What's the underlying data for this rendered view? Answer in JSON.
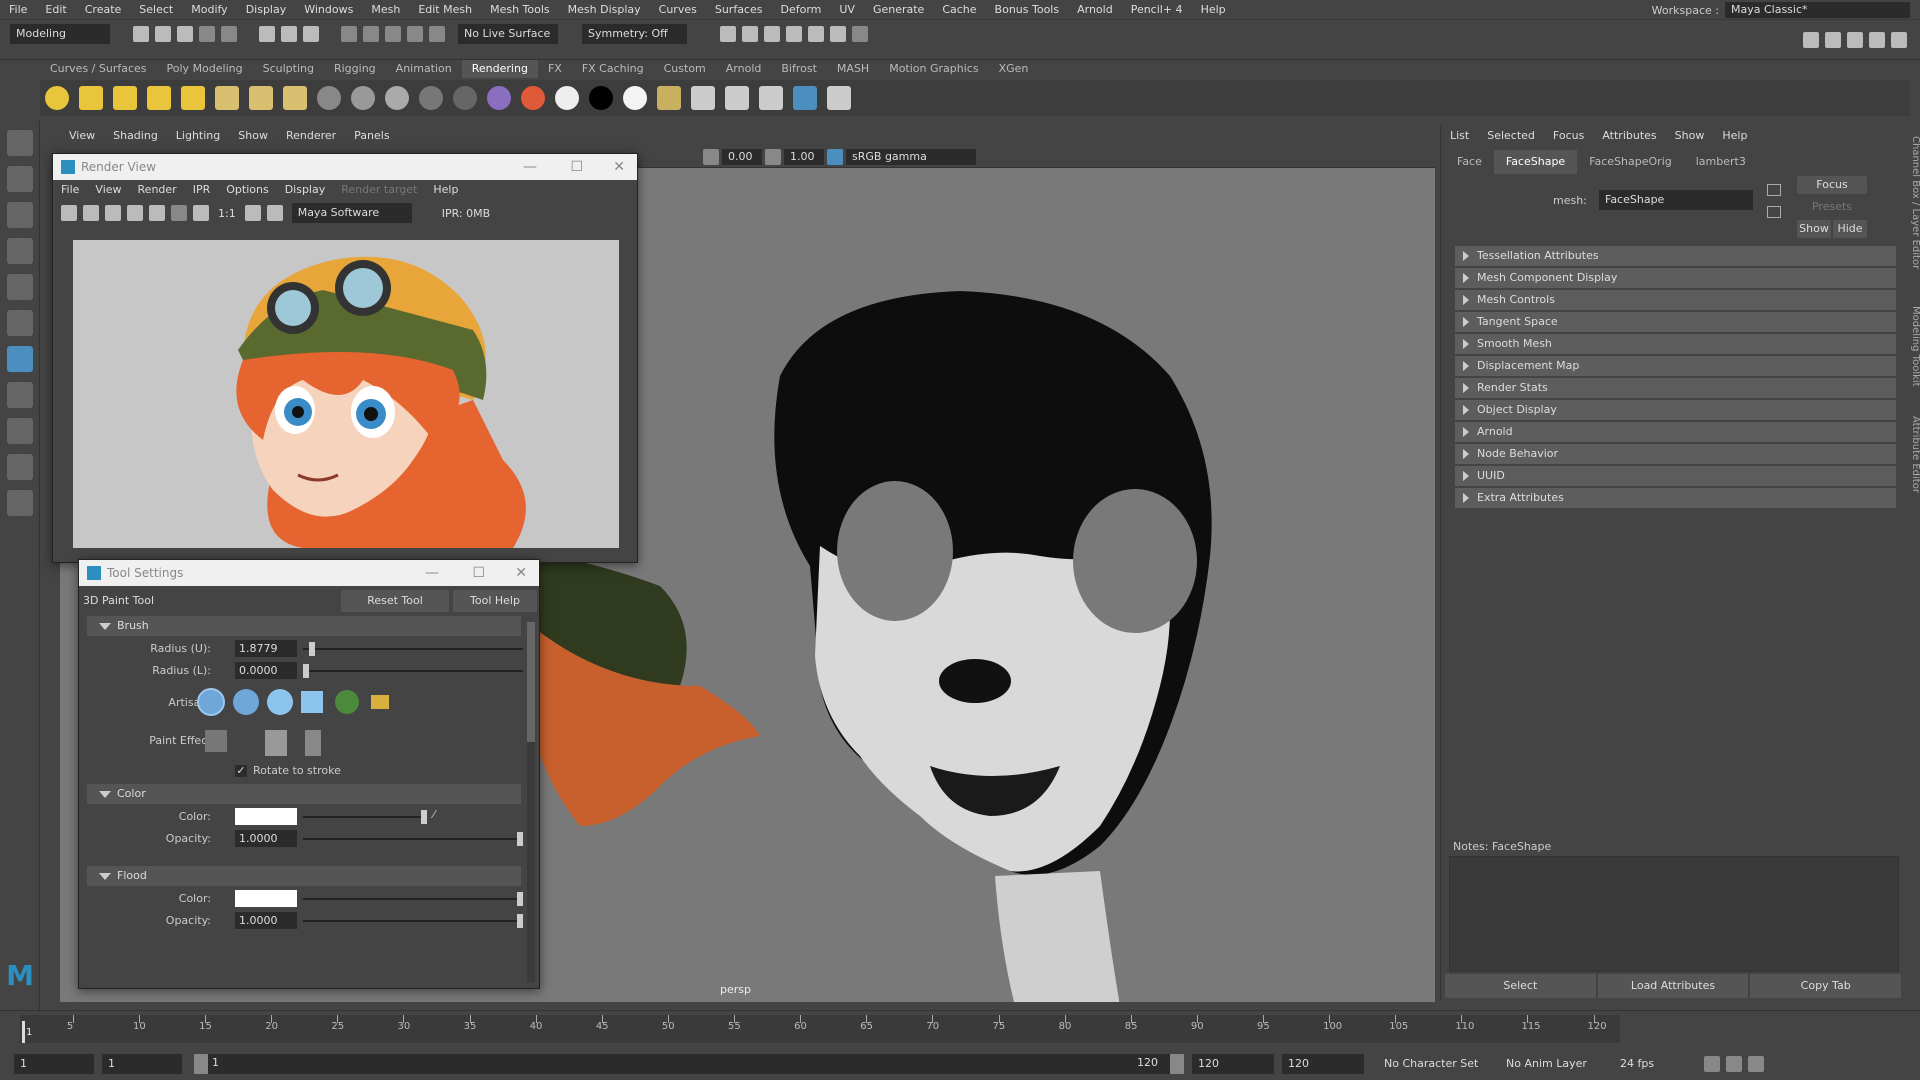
{
  "menubar": {
    "items": [
      "File",
      "Edit",
      "Create",
      "Select",
      "Modify",
      "Display",
      "Windows",
      "Mesh",
      "Edit Mesh",
      "Mesh Tools",
      "Mesh Display",
      "Curves",
      "Surfaces",
      "Deform",
      "UV",
      "Generate",
      "Cache",
      "Bonus Tools",
      "Arnold",
      "Pencil+ 4",
      "Help"
    ],
    "workspace_label": "Workspace :",
    "workspace_value": "Maya Classic*"
  },
  "statusline": {
    "mode": "Modeling",
    "live_surface": "No Live Surface",
    "symmetry": "Symmetry: Off"
  },
  "shelf": {
    "tabs": [
      "Curves / Surfaces",
      "Poly Modeling",
      "Sculpting",
      "Rigging",
      "Animation",
      "Rendering",
      "FX",
      "FX Caching",
      "Custom",
      "Arnold",
      "Bifrost",
      "MASH",
      "Motion Graphics",
      "XGen"
    ],
    "active_tab": "Rendering"
  },
  "viewport": {
    "menu": [
      "View",
      "Shading",
      "Lighting",
      "Show",
      "Renderer",
      "Panels"
    ],
    "exposure": "0.00",
    "gamma": "1.00",
    "color_space": "sRGB gamma",
    "camera_label": "persp"
  },
  "renderview": {
    "title": "Render View",
    "menu": [
      "File",
      "View",
      "Render",
      "IPR",
      "Options",
      "Display",
      "Render target",
      "Help"
    ],
    "ratio": "1:1",
    "renderer": "Maya Software",
    "ipr_label": "IPR: 0MB"
  },
  "toolsettings": {
    "title": "Tool Settings",
    "tool_name": "3D Paint Tool",
    "reset_label": "Reset Tool",
    "help_label": "Tool Help",
    "brush_header": "Brush",
    "radius_u_label": "Radius (U):",
    "radius_u": "1.8779",
    "radius_l_label": "Radius (L):",
    "radius_l": "0.0000",
    "artisan_label": "Artisan:",
    "paint_effects_label": "Paint Effects:",
    "rotate_label": "Rotate to stroke",
    "color_header": "Color",
    "color_label": "Color:",
    "opacity_label": "Opacity:",
    "opacity": "1.0000",
    "flood_header": "Flood",
    "flood_color_label": "Color:",
    "flood_opacity_label": "Opacity:",
    "flood_opacity": "1.0000"
  },
  "attreditor": {
    "menu": [
      "List",
      "Selected",
      "Focus",
      "Attributes",
      "Show",
      "Help"
    ],
    "tabs": [
      "Face",
      "FaceShape",
      "FaceShapeOrig",
      "lambert3"
    ],
    "active_tab": "FaceShape",
    "mesh_label": "mesh:",
    "mesh_value": "FaceShape",
    "focus_label": "Focus",
    "presets_label": "Presets",
    "show_label": "Show",
    "hide_label": "Hide",
    "sections": [
      "Tessellation Attributes",
      "Mesh Component Display",
      "Mesh Controls",
      "Tangent Space",
      "Smooth Mesh",
      "Displacement Map",
      "Render Stats",
      "Object Display",
      "Arnold",
      "Node Behavior",
      "UUID",
      "Extra Attributes"
    ],
    "notes_label": "Notes: FaceShape",
    "select_label": "Select",
    "load_label": "Load Attributes",
    "copy_label": "Copy Tab",
    "side_tabs": [
      "Channel Box / Layer Editor",
      "Modeling Toolkit",
      "Attribute Editor"
    ]
  },
  "timeline": {
    "ticks": [
      "5",
      "10",
      "15",
      "20",
      "25",
      "30",
      "35",
      "40",
      "45",
      "50",
      "55",
      "60",
      "65",
      "70",
      "75",
      "80",
      "85",
      "90",
      "95",
      "100",
      "105",
      "110",
      "115",
      "120"
    ],
    "current_frame": "1",
    "start": "1",
    "range_start": "1",
    "range_start_inner": "1",
    "range_end_inner": "120",
    "range_end": "120",
    "end": "120",
    "character_set": "No Character Set",
    "anim_layer": "No Anim Layer",
    "fps": "24 fps"
  },
  "colors": {
    "accent": "#4a8fc0",
    "viewport_bg": "#797979",
    "panel_bg": "#444444"
  }
}
